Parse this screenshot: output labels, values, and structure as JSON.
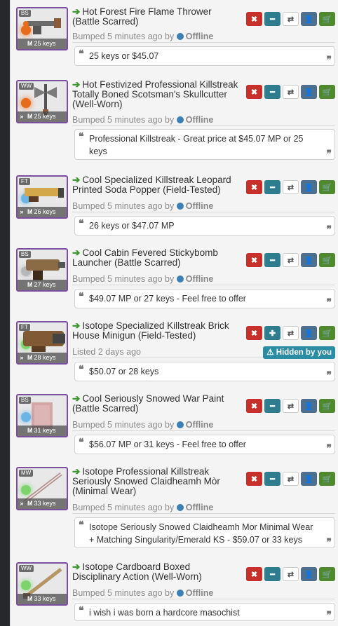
{
  "listings": [
    {
      "wear": "BS",
      "effect_color": "#e66b1a",
      "killstreak": false,
      "price": "25 keys",
      "title": "Hot Forest Fire Flame Thrower (Battle Scarred)",
      "status_prefix": "Bumped 5 minutes ago by",
      "status_user": "Offline",
      "message": "25 keys or $45.07",
      "buttons": [
        "close-icon",
        "minus-icon",
        "refresh-icon",
        "add-user-icon",
        "cart-icon"
      ]
    },
    {
      "wear": "WW",
      "effect_color": "#e66b1a",
      "killstreak": true,
      "price": "25 keys",
      "title": "Hot Festivized Professional Killstreak Totally Boned Scotsman's Skullcutter (Well-Worn)",
      "status_prefix": "Bumped 5 minutes ago by",
      "status_user": "Offline",
      "message": "Professional Killstreak - Great price at $45.07 MP or 25 keys",
      "buttons": [
        "close-icon",
        "minus-icon",
        "refresh-icon",
        "add-user-icon",
        "cart-icon"
      ]
    },
    {
      "wear": "FT",
      "effect_color": "#6bb4e6",
      "killstreak": true,
      "price": "26 keys",
      "title": "Cool Specialized Killstreak Leopard Printed Soda Popper (Field-Tested)",
      "status_prefix": "Bumped 5 minutes ago by",
      "status_user": "Offline",
      "message": "26 keys or $47.07 MP",
      "buttons": [
        "close-icon",
        "minus-icon",
        "refresh-icon",
        "add-user-icon",
        "cart-icon"
      ]
    },
    {
      "wear": "BS",
      "effect_color": "#b7b7b7",
      "killstreak": false,
      "price": "27 keys",
      "title": "Cool Cabin Fevered Stickybomb Launcher (Battle Scarred)",
      "status_prefix": "Bumped 5 minutes ago by",
      "status_user": "Offline",
      "message": "$49.07 MP or 27 keys - Feel free to offer",
      "buttons": [
        "close-icon",
        "minus-icon",
        "refresh-icon",
        "add-user-icon",
        "cart-icon"
      ]
    },
    {
      "wear": "FT",
      "effect_color": "#7ed36b",
      "killstreak": true,
      "price": "28 keys",
      "title": "Isotope Specialized Killstreak Brick House Minigun (Field-Tested)",
      "status_prefix": "Listed 2 days ago",
      "status_user": "",
      "hidden_label": "Hidden by you",
      "message": "$50.07 or 28 keys",
      "buttons": [
        "close-icon",
        "plus-icon",
        "refresh-icon",
        "add-user-icon",
        "cart-icon"
      ]
    },
    {
      "wear": "BS",
      "effect_color": "#6bb4e6",
      "killstreak": false,
      "price": "31 keys",
      "title": "Cool Seriously Snowed War Paint (Battle Scarred)",
      "status_prefix": "Bumped 5 minutes ago by",
      "status_user": "Offline",
      "message": "$56.07 MP or 31 keys - Feel free to offer",
      "buttons": [
        "close-icon",
        "minus-icon",
        "refresh-icon",
        "add-user-icon",
        "cart-icon"
      ]
    },
    {
      "wear": "MW",
      "effect_color": "#7ed36b",
      "killstreak": true,
      "price": "33 keys",
      "title": "Isotope Professional Killstreak Seriously Snowed Claidheamh Mòr (Minimal Wear)",
      "status_prefix": "Bumped 5 minutes ago by",
      "status_user": "Offline",
      "message": "Isotope Seriously Snowed Claidheamh Mor Minimal Wear + Matching Singularity/Emerald KS - $59.07 or 33 keys",
      "buttons": [
        "close-icon",
        "minus-icon",
        "refresh-icon",
        "add-user-icon",
        "cart-icon"
      ]
    },
    {
      "wear": "WW",
      "effect_color": "#7ed36b",
      "killstreak": false,
      "price": "33 keys",
      "title": "Isotope Cardboard Boxed Disciplinary Action (Well-Worn)",
      "status_prefix": "Bumped 5 minutes ago by",
      "status_user": "Offline",
      "message": "i wish i was born a hardcore masochist",
      "buttons": [
        "close-icon",
        "minus-icon",
        "refresh-icon",
        "add-user-icon",
        "cart-icon"
      ]
    }
  ],
  "glyphs": {
    "arrow": "➔",
    "ks": "»",
    "m": "M",
    "quote_open": "❝",
    "quote_close": "❞",
    "globe": "⬤",
    "warning": "⚠"
  }
}
